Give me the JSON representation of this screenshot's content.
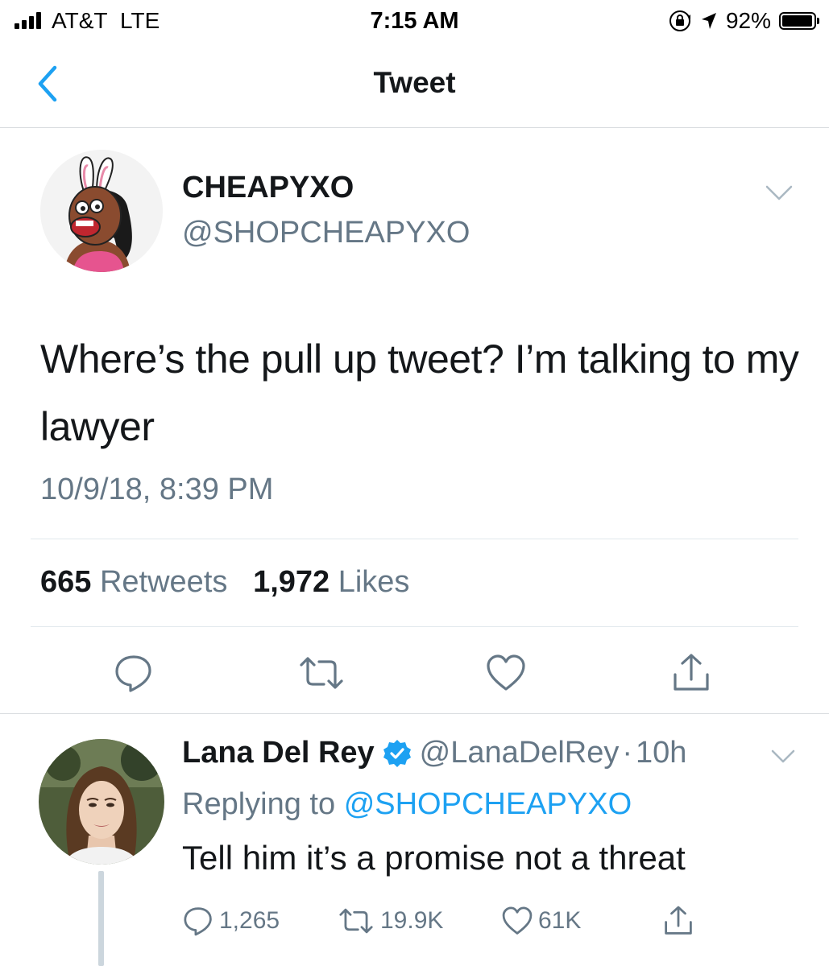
{
  "status_bar": {
    "carrier": "AT&T",
    "network": "LTE",
    "time": "7:15 AM",
    "battery_percent": "92%"
  },
  "nav": {
    "title": "Tweet"
  },
  "tweet": {
    "author_name": "CHEAPYXO",
    "author_handle": "@SHOPCHEAPYXO",
    "text": "Where’s the pull up tweet? I’m talking to my lawyer",
    "timestamp": "10/9/18, 8:39 PM",
    "stats": {
      "retweets_count": "665",
      "retweets_label": "Retweets",
      "likes_count": "1,972",
      "likes_label": "Likes"
    }
  },
  "reply": {
    "author_name": "Lana Del Rey",
    "author_handle": "@LanaDelRey",
    "separator": "·",
    "age": "10h",
    "replying_prefix": "Replying to",
    "replying_to": "@SHOPCHEAPYXO",
    "text": "Tell him it’s a promise not a threat",
    "counts": {
      "replies": "1,265",
      "retweets": "19.9K",
      "likes": "61K"
    }
  },
  "colors": {
    "link_blue": "#1da1f2",
    "secondary_gray": "#657786",
    "text_dark": "#14171a",
    "divider": "#e1e8ed",
    "verified_blue": "#1da1f2"
  },
  "icons": {
    "back": "chevron-left-icon",
    "caret": "chevron-down-icon",
    "reply": "speech-bubble-icon",
    "retweet": "retweet-icon",
    "like": "heart-icon",
    "share": "share-icon",
    "verified": "verified-badge-icon"
  }
}
